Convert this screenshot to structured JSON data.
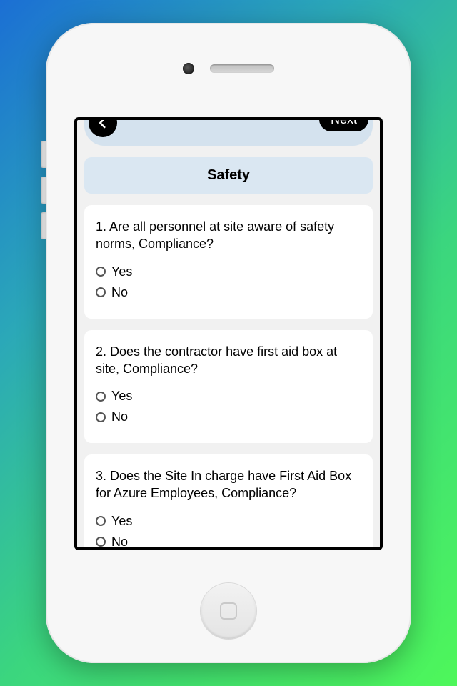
{
  "nav": {
    "next_label": "Next"
  },
  "section_title": "Safety",
  "questions": [
    {
      "text": "1. Are all personnel at site aware of safety norms, Compliance?",
      "options": [
        "Yes",
        "No"
      ]
    },
    {
      "text": "2. Does the contractor have first aid box at site, Compliance?",
      "options": [
        "Yes",
        "No"
      ]
    },
    {
      "text": "3. Does the Site In charge have First Aid Box for Azure Employees, Compliance?",
      "options": [
        "Yes",
        "No"
      ]
    }
  ]
}
